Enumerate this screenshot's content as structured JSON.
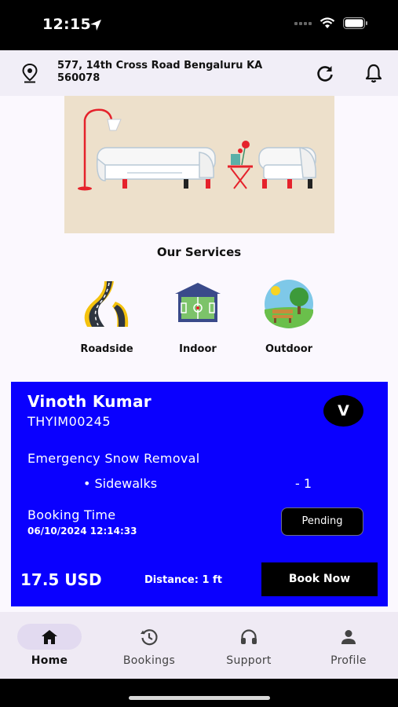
{
  "status_bar": {
    "time": "12:15"
  },
  "header": {
    "address": "577, 14th Cross Road Bengaluru KA 560078"
  },
  "services": {
    "title": "Our Services",
    "items": [
      {
        "label": "Roadside",
        "icon": "road-icon"
      },
      {
        "label": "Indoor",
        "icon": "indoor-court-icon"
      },
      {
        "label": "Outdoor",
        "icon": "park-bench-icon"
      }
    ]
  },
  "booking": {
    "customer_name": "Vinoth Kumar",
    "customer_code": "THYIM00245",
    "avatar_initial": "V",
    "service_name": "Emergency Snow Removal",
    "item_name": "• Sidewalks",
    "item_qty": "- 1",
    "booking_time_label": "Booking Time",
    "booking_time": "06/10/2024 12:14:33",
    "status": "Pending",
    "price": "17.5 USD",
    "distance": "Distance: 1 ft",
    "book_button": "Book Now",
    "card_color": "#0a00ff"
  },
  "nav": {
    "items": [
      {
        "label": "Home",
        "icon": "home-icon",
        "active": true
      },
      {
        "label": "Bookings",
        "icon": "history-icon",
        "active": false
      },
      {
        "label": "Support",
        "icon": "headset-icon",
        "active": false
      },
      {
        "label": "Profile",
        "icon": "person-icon",
        "active": false
      }
    ]
  }
}
